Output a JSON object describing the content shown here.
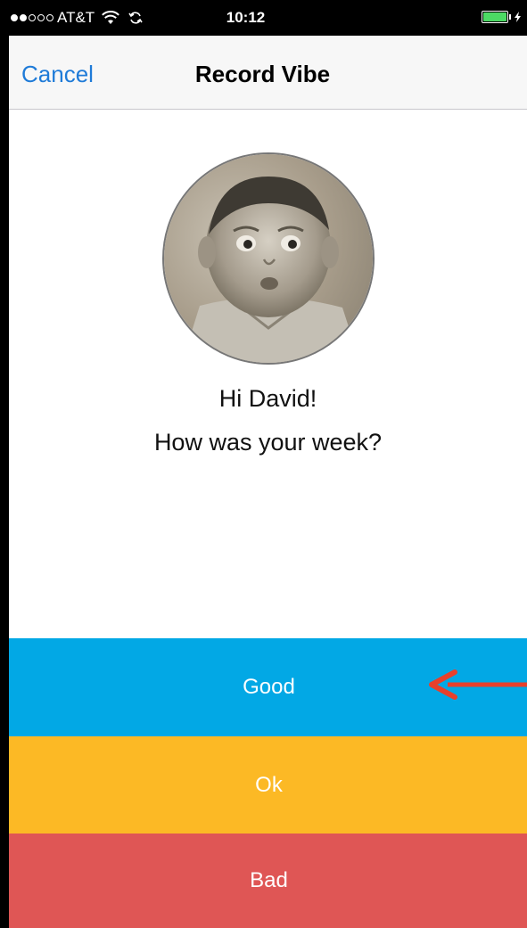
{
  "status_bar": {
    "carrier": "AT&T",
    "signal": {
      "filled": 2,
      "total": 5
    },
    "time": "10:12",
    "battery_level": 1.0,
    "battery_color": "#4cd964",
    "icons": [
      "wifi-icon",
      "sync-icon",
      "battery-icon",
      "charging-bolt-icon"
    ]
  },
  "nav": {
    "cancel_label": "Cancel",
    "title": "Record Vibe",
    "accent": "#1f7bd8"
  },
  "profile": {
    "avatar_icon": "avatar-photo",
    "greeting": "Hi David!",
    "question": "How was your week?"
  },
  "moods": [
    {
      "label": "Good",
      "color": "#02a8e5"
    },
    {
      "label": "Ok",
      "color": "#fcb925"
    },
    {
      "label": "Bad",
      "color": "#df5655"
    }
  ],
  "annotation": {
    "icon": "red-arrow-pointer",
    "color": "#e8402b"
  }
}
